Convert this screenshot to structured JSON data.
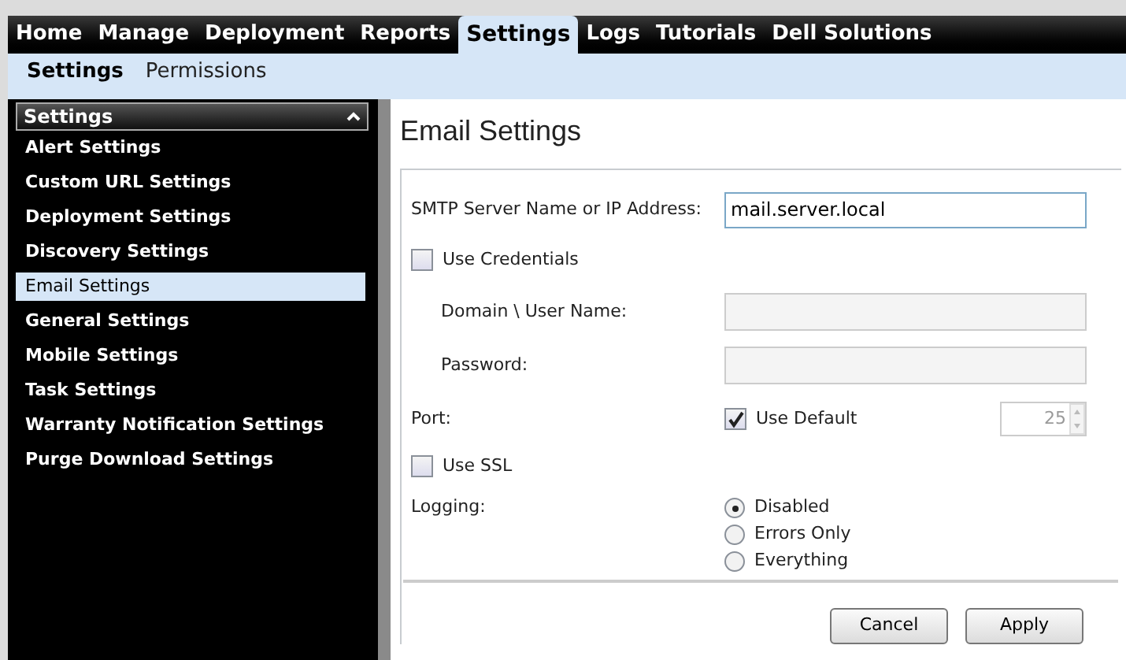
{
  "nav": {
    "tabs": [
      {
        "label": "Home",
        "selected": false
      },
      {
        "label": "Manage",
        "selected": false
      },
      {
        "label": "Deployment",
        "selected": false
      },
      {
        "label": "Reports",
        "selected": false
      },
      {
        "label": "Settings",
        "selected": true
      },
      {
        "label": "Logs",
        "selected": false
      },
      {
        "label": "Tutorials",
        "selected": false
      },
      {
        "label": "Dell Solutions",
        "selected": false
      }
    ]
  },
  "subnav": {
    "items": [
      {
        "label": "Settings",
        "selected": true
      },
      {
        "label": "Permissions",
        "selected": false
      }
    ]
  },
  "sidebar": {
    "title": "Settings",
    "expanded": true,
    "items": [
      {
        "label": "Alert Settings",
        "selected": false
      },
      {
        "label": "Custom URL Settings",
        "selected": false
      },
      {
        "label": "Deployment Settings",
        "selected": false
      },
      {
        "label": "Discovery Settings",
        "selected": false
      },
      {
        "label": "Email Settings",
        "selected": true
      },
      {
        "label": "General Settings",
        "selected": false
      },
      {
        "label": "Mobile Settings",
        "selected": false
      },
      {
        "label": "Task Settings",
        "selected": false
      },
      {
        "label": "Warranty Notification Settings",
        "selected": false
      },
      {
        "label": "Purge Download Settings",
        "selected": false
      }
    ]
  },
  "page": {
    "title": "Email Settings",
    "smtp": {
      "label": "SMTP Server Name or IP Address:",
      "value": "mail.server.local"
    },
    "use_credentials": {
      "label": "Use Credentials",
      "checked": false
    },
    "domain_user": {
      "label": "Domain \\ User Name:",
      "disabled": true
    },
    "password": {
      "label": "Password:",
      "disabled": true
    },
    "port": {
      "label": "Port:",
      "use_default": {
        "label": "Use Default",
        "checked": true
      },
      "value": "25",
      "disabled": true
    },
    "use_ssl": {
      "label": "Use SSL",
      "checked": false
    },
    "logging": {
      "label": "Logging:",
      "options": [
        {
          "label": "Disabled",
          "selected": true
        },
        {
          "label": "Errors Only",
          "selected": false
        },
        {
          "label": "Everything",
          "selected": false
        }
      ]
    },
    "buttons": [
      "Cancel",
      "Apply"
    ]
  }
}
